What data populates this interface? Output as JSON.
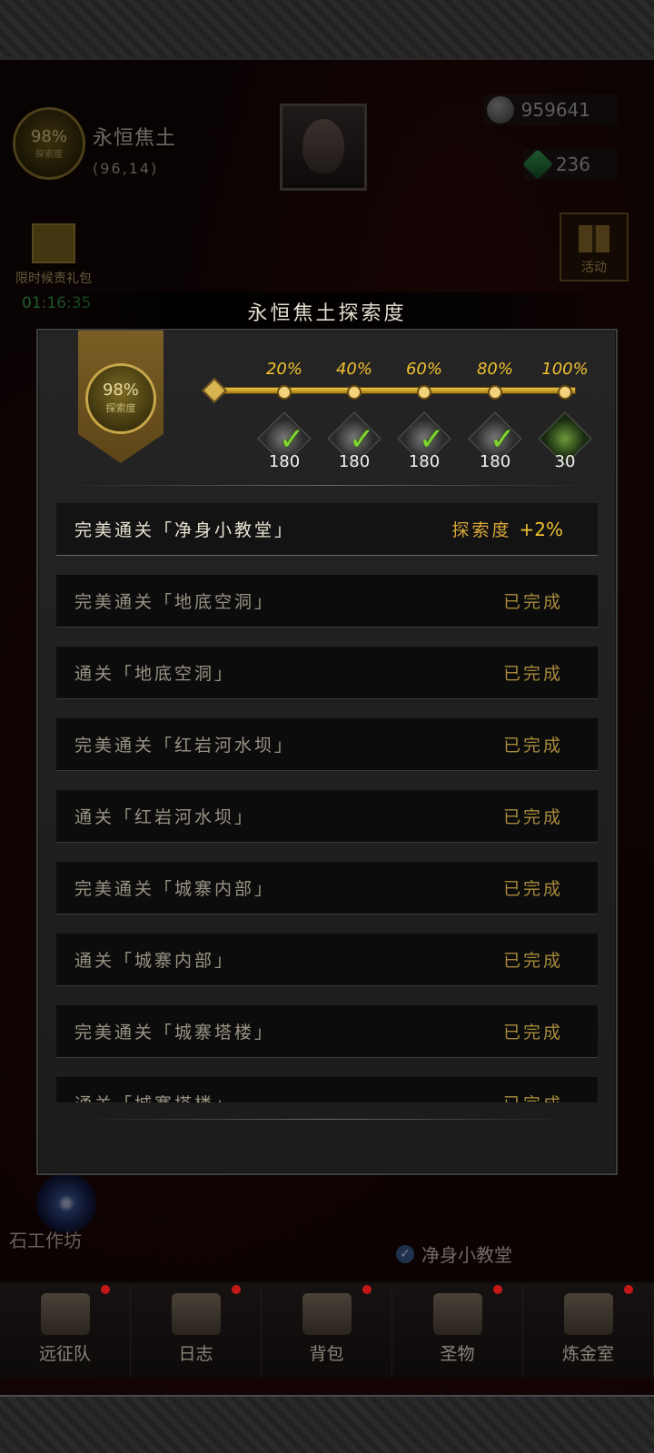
{
  "hud": {
    "area_badge_percent": "98%",
    "area_badge_label": "探索度",
    "area_name": "永恒焦土",
    "area_coords": "(96,14)",
    "silver": "959641",
    "gems": "236",
    "event_label": "活动",
    "gift_pack_label": "限时候责礼包",
    "gift_timer": "01:16:35",
    "portal_label": "石工作坊",
    "checkpoint_label": "净身小教堂"
  },
  "modal": {
    "title": "永恒焦土探索度",
    "progress_percent": "98%",
    "progress_label": "探索度",
    "progress_value": 0.98,
    "milestones": [
      {
        "percent": "20%",
        "qty": "180",
        "reward_icon": "ore-icon",
        "claimed": true
      },
      {
        "percent": "40%",
        "qty": "180",
        "reward_icon": "ore-icon",
        "claimed": true
      },
      {
        "percent": "60%",
        "qty": "180",
        "reward_icon": "ore-icon",
        "claimed": true
      },
      {
        "percent": "80%",
        "qty": "180",
        "reward_icon": "ore-icon",
        "claimed": true
      },
      {
        "percent": "100%",
        "qty": "30",
        "reward_icon": "potion-icon",
        "claimed": false
      }
    ],
    "tasks": [
      {
        "name": "完美通关「净身小教堂」",
        "status": "探索度",
        "bonus": "+2%",
        "active": true
      },
      {
        "name": "完美通关「地底空洞」",
        "status": "已完成"
      },
      {
        "name": "通关「地底空洞」",
        "status": "已完成"
      },
      {
        "name": "完美通关「红岩河水坝」",
        "status": "已完成"
      },
      {
        "name": "通关「红岩河水坝」",
        "status": "已完成"
      },
      {
        "name": "完美通关「城寨内部」",
        "status": "已完成"
      },
      {
        "name": "通关「城寨内部」",
        "status": "已完成"
      },
      {
        "name": "完美通关「城寨塔楼」",
        "status": "已完成"
      },
      {
        "name": "通关「城寨塔楼」",
        "status": "已完成"
      }
    ]
  },
  "nav": {
    "items": [
      {
        "label": "远征队",
        "icon": "helmet-icon"
      },
      {
        "label": "日志",
        "icon": "map-icon"
      },
      {
        "label": "背包",
        "icon": "backpack-icon"
      },
      {
        "label": "圣物",
        "icon": "chalice-icon"
      },
      {
        "label": "炼金室",
        "icon": "alchemy-icon"
      }
    ]
  },
  "colors": {
    "accent_gold": "#f0c030",
    "claimed_green": "#7ed630",
    "notification_red": "#c41818"
  }
}
